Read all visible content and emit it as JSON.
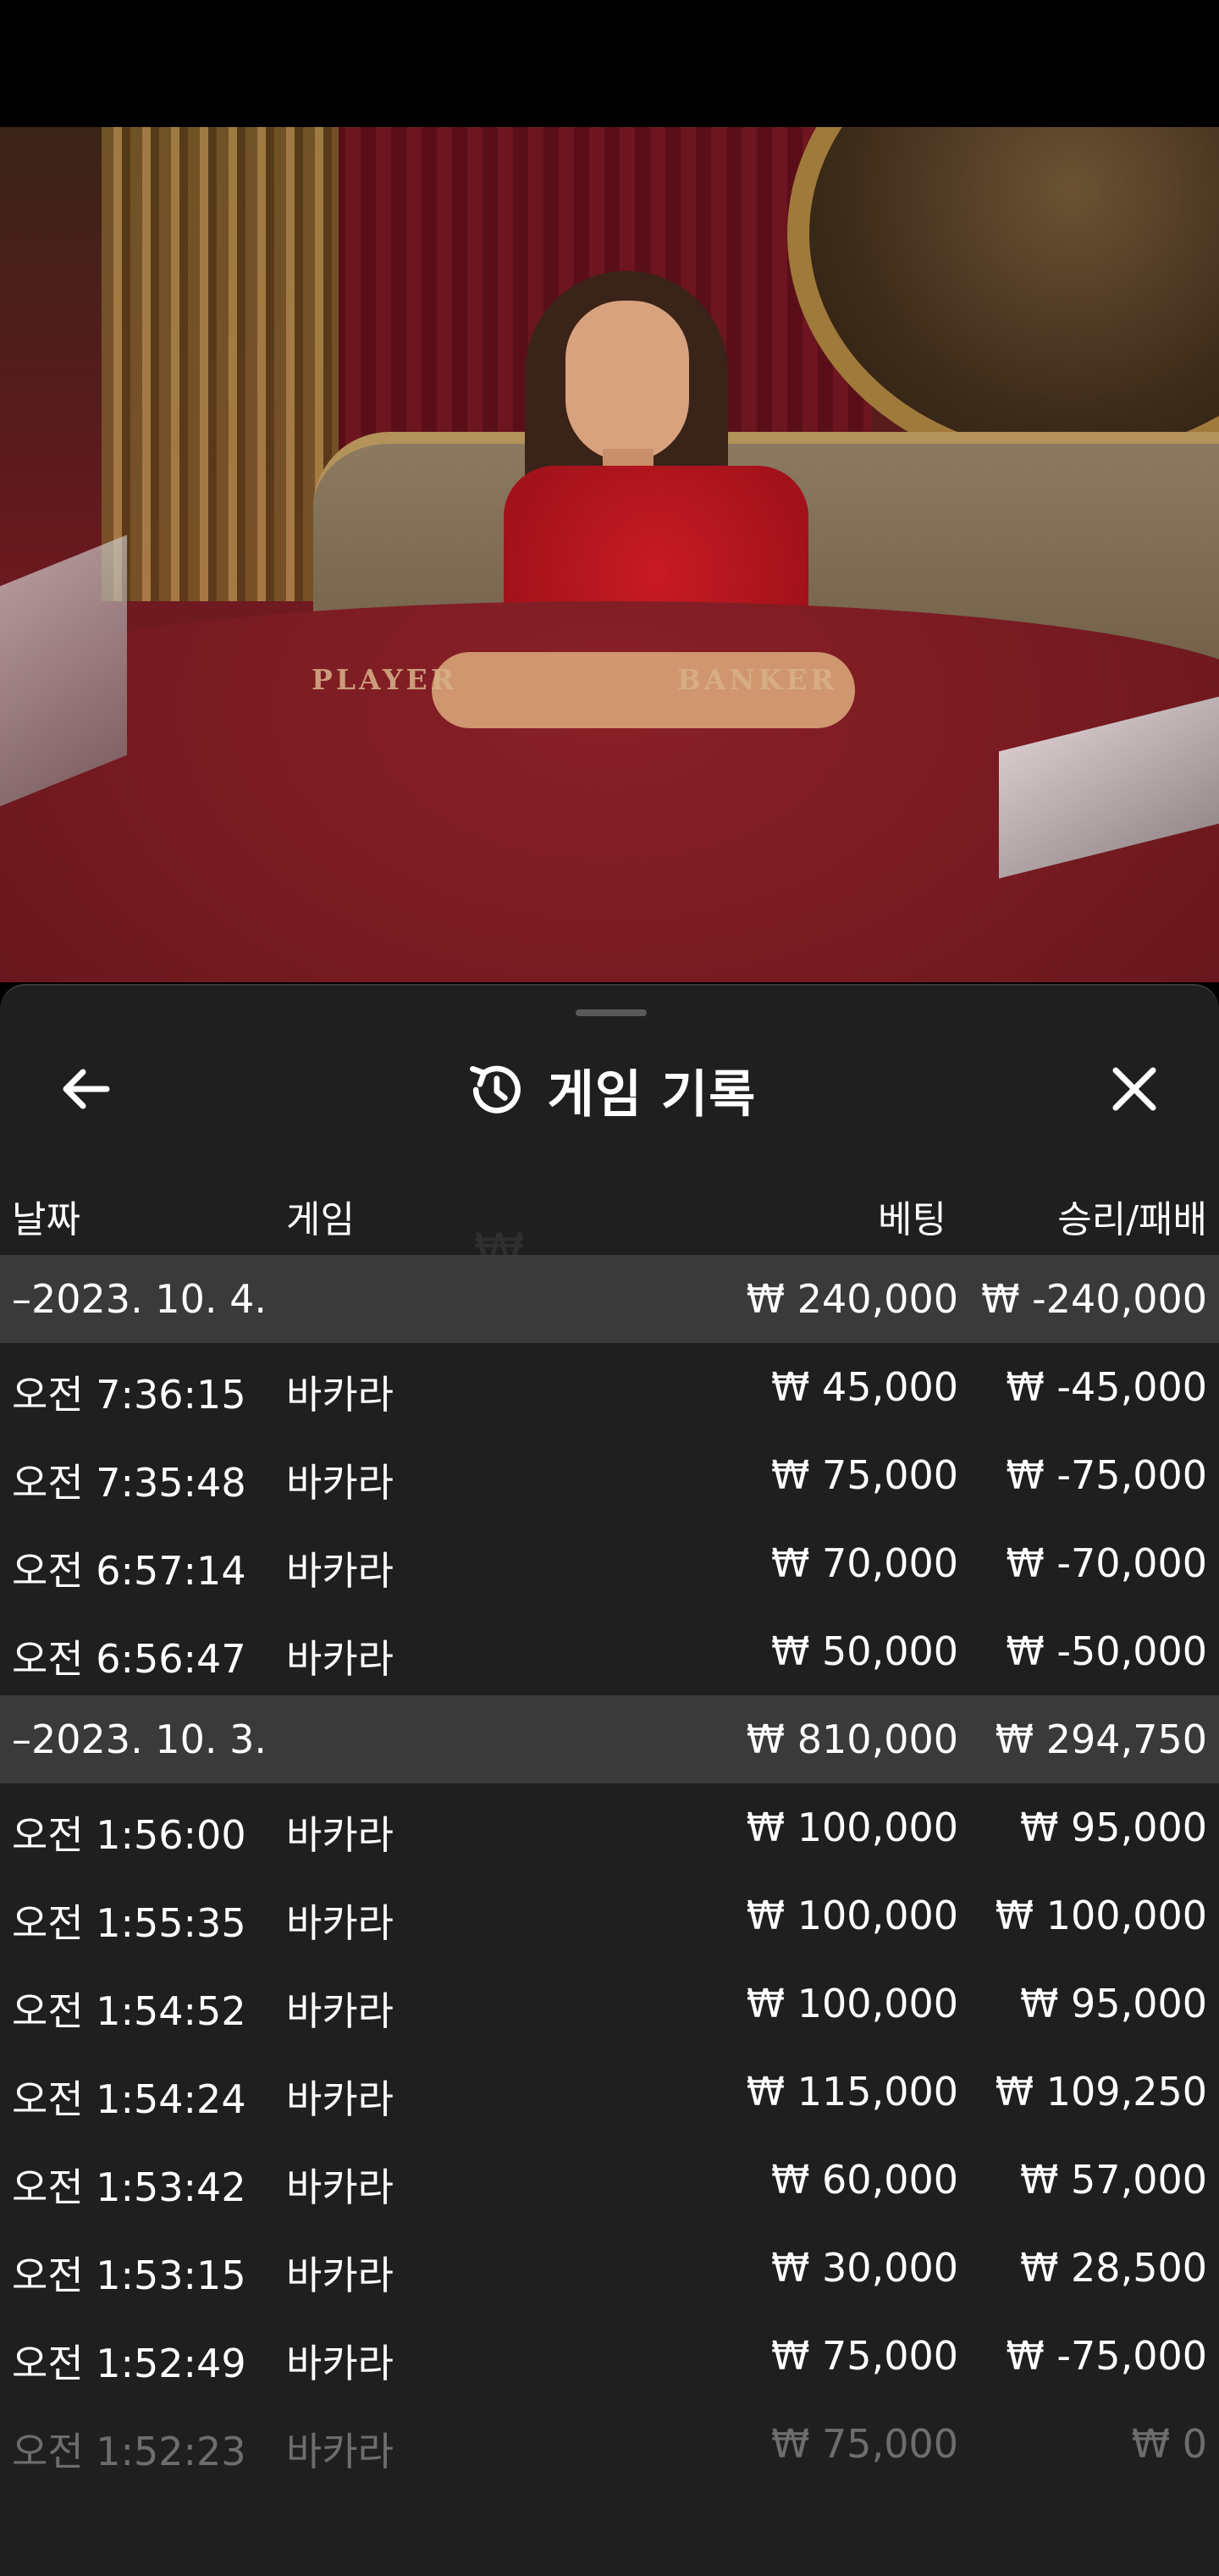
{
  "live_video": {
    "felt_labels": {
      "player": "PLAYER",
      "banker": "BANKER"
    }
  },
  "history_panel": {
    "title": "게임 기록",
    "icons": {
      "back": "arrow-left-icon",
      "close": "close-icon",
      "title": "history-icon"
    },
    "columns": {
      "date": "날짜",
      "game": "게임",
      "bet": "베팅",
      "result": "승리/패배"
    },
    "groups": [
      {
        "date": "–2023. 10. 4.",
        "total_bet": "₩ 240,000",
        "total_result": "₩ -240,000",
        "rows": [
          {
            "time": "오전 7:36:15",
            "game": "바카라",
            "bet": "₩ 45,000",
            "result": "₩ -45,000"
          },
          {
            "time": "오전 7:35:48",
            "game": "바카라",
            "bet": "₩ 75,000",
            "result": "₩ -75,000"
          },
          {
            "time": "오전 6:57:14",
            "game": "바카라",
            "bet": "₩ 70,000",
            "result": "₩ -70,000"
          },
          {
            "time": "오전 6:56:47",
            "game": "바카라",
            "bet": "₩ 50,000",
            "result": "₩ -50,000"
          }
        ]
      },
      {
        "date": "–2023. 10. 3.",
        "total_bet": "₩ 810,000",
        "total_result": "₩ 294,750",
        "rows": [
          {
            "time": "오전 1:56:00",
            "game": "바카라",
            "bet": "₩ 100,000",
            "result": "₩ 95,000"
          },
          {
            "time": "오전 1:55:35",
            "game": "바카라",
            "bet": "₩ 100,000",
            "result": "₩ 100,000"
          },
          {
            "time": "오전 1:54:52",
            "game": "바카라",
            "bet": "₩ 100,000",
            "result": "₩ 95,000"
          },
          {
            "time": "오전 1:54:24",
            "game": "바카라",
            "bet": "₩ 115,000",
            "result": "₩ 109,250"
          },
          {
            "time": "오전 1:53:42",
            "game": "바카라",
            "bet": "₩ 60,000",
            "result": "₩ 57,000"
          },
          {
            "time": "오전 1:53:15",
            "game": "바카라",
            "bet": "₩ 30,000",
            "result": "₩ 28,500"
          },
          {
            "time": "오전 1:52:49",
            "game": "바카라",
            "bet": "₩ 75,000",
            "result": "₩ -75,000"
          },
          {
            "time": "오전 1:52:23",
            "game": "바카라",
            "bet": "₩ 75,000",
            "result": "₩ 0"
          }
        ]
      }
    ]
  }
}
